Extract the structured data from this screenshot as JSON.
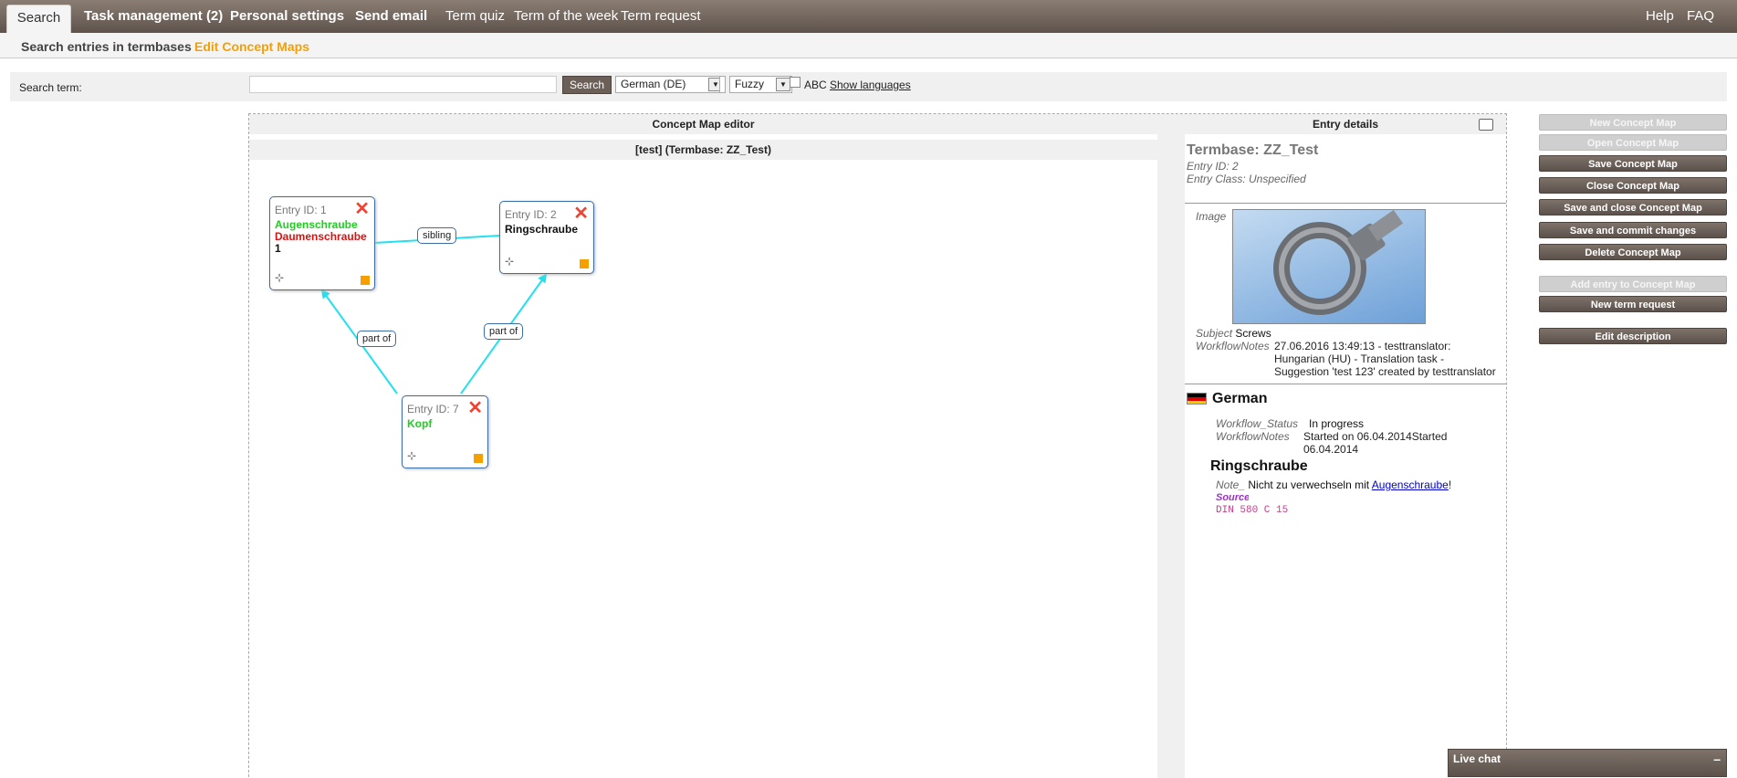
{
  "nav": {
    "tabs": [
      "Search",
      "Task management (2)",
      "Personal settings",
      "Send email",
      "Term quiz",
      "Term of the week",
      "Term request"
    ],
    "right": [
      "Help",
      "FAQ"
    ]
  },
  "subnav": {
    "items": [
      "Search entries in termbases",
      "Edit Concept Maps"
    ],
    "active_color": "#f5a000"
  },
  "search": {
    "label": "Search term:",
    "value": "",
    "button": "Search",
    "language": "German (DE)",
    "mode": "Fuzzy",
    "abc_label": "ABC",
    "abc_checked": false,
    "show_languages": "Show languages"
  },
  "concept_map": {
    "header": "Concept Map editor",
    "subheader": "[test] (Termbase: ZZ_Test)",
    "nodes": [
      {
        "entry": "Entry ID: 1",
        "terms": [
          {
            "text": "Augenschraube",
            "color": "#22cc22"
          },
          {
            "text": "Daumenschraube",
            "color": "#e01010"
          },
          {
            "text": "1",
            "color": "#111111"
          }
        ]
      },
      {
        "entry": "Entry ID: 2",
        "terms": [
          {
            "text": "Ringschraube",
            "color": "#111111"
          }
        ]
      },
      {
        "entry": "Entry ID: 7",
        "terms": [
          {
            "text": "Kopf",
            "color": "#22cc22"
          }
        ]
      }
    ],
    "relations": [
      "sibling",
      "part of",
      "part of"
    ],
    "line_color": "#22e0f0",
    "tree_icon": "tree-structure-icon",
    "close_icon": "close-x-icon"
  },
  "entry": {
    "header": "Entry details",
    "termbase": "Termbase: ZZ_Test",
    "entry_id": "Entry ID: 2",
    "entry_class": "Entry Class: Unspecified",
    "image_label": "Image",
    "subject_label": "Subject",
    "subject": "Screws",
    "workflow_notes_label": "WorkflowNotes",
    "workflow_notes": [
      "27.06.2016 13:49:13 - testtranslator:",
      "Hungarian (HU) - Translation task -",
      "Suggestion 'test 123' created by testtranslator"
    ],
    "language": "German",
    "workflow_status_label": "Workflow_Status",
    "workflow_status": "In progress",
    "lang_workflow_notes_label": "WorkflowNotes",
    "lang_workflow_notes": [
      "Started on 06.04.2014Started",
      "06.04.2014"
    ],
    "term": "Ringschraube",
    "note_label": "Note_",
    "note_text": "Nicht zu verwechseln mit ",
    "note_link": "Augenschraube",
    "note_end": "!",
    "source_label": "Source",
    "source_value": "DIN 580 C 15"
  },
  "buttons": [
    {
      "label": "New Concept Map",
      "enabled": false
    },
    {
      "label": "Open Concept Map",
      "enabled": false
    },
    {
      "label": "Save Concept Map",
      "enabled": true
    },
    {
      "label": "Close Concept Map",
      "enabled": true
    },
    {
      "label": "Save and close Concept Map",
      "enabled": true
    },
    {
      "label": "Save and commit changes",
      "enabled": true
    },
    {
      "label": "Delete Concept Map",
      "enabled": true
    },
    {
      "label": "Add entry to Concept Map",
      "enabled": false
    },
    {
      "label": "New term request",
      "enabled": true
    },
    {
      "label": "Edit description",
      "enabled": true
    }
  ],
  "livechat": {
    "title": "Live chat",
    "minimize": "–"
  }
}
